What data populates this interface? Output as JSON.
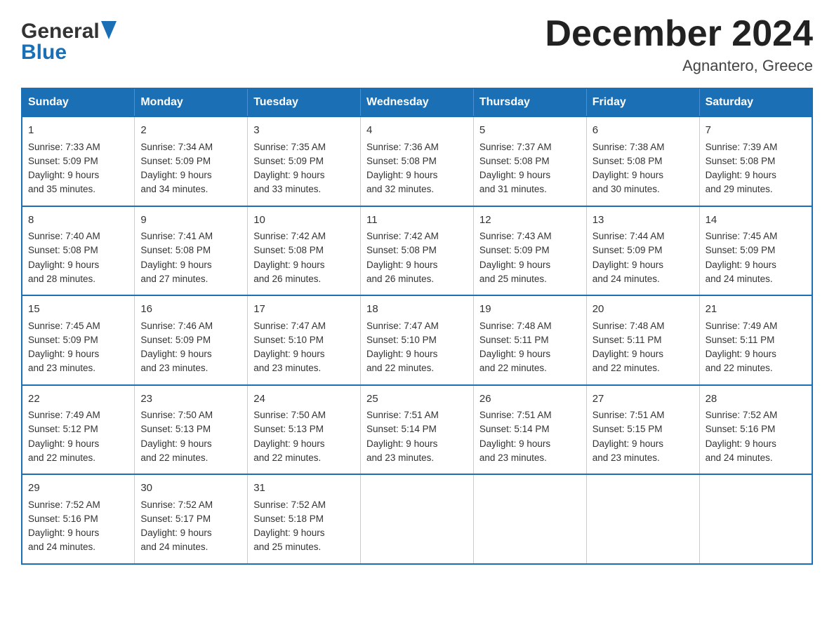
{
  "header": {
    "title": "December 2024",
    "location": "Agnantero, Greece",
    "logo_general": "General",
    "logo_blue": "Blue"
  },
  "columns": [
    "Sunday",
    "Monday",
    "Tuesday",
    "Wednesday",
    "Thursday",
    "Friday",
    "Saturday"
  ],
  "weeks": [
    [
      {
        "day": "1",
        "sunrise": "7:33 AM",
        "sunset": "5:09 PM",
        "daylight": "9 hours and 35 minutes."
      },
      {
        "day": "2",
        "sunrise": "7:34 AM",
        "sunset": "5:09 PM",
        "daylight": "9 hours and 34 minutes."
      },
      {
        "day": "3",
        "sunrise": "7:35 AM",
        "sunset": "5:09 PM",
        "daylight": "9 hours and 33 minutes."
      },
      {
        "day": "4",
        "sunrise": "7:36 AM",
        "sunset": "5:08 PM",
        "daylight": "9 hours and 32 minutes."
      },
      {
        "day": "5",
        "sunrise": "7:37 AM",
        "sunset": "5:08 PM",
        "daylight": "9 hours and 31 minutes."
      },
      {
        "day": "6",
        "sunrise": "7:38 AM",
        "sunset": "5:08 PM",
        "daylight": "9 hours and 30 minutes."
      },
      {
        "day": "7",
        "sunrise": "7:39 AM",
        "sunset": "5:08 PM",
        "daylight": "9 hours and 29 minutes."
      }
    ],
    [
      {
        "day": "8",
        "sunrise": "7:40 AM",
        "sunset": "5:08 PM",
        "daylight": "9 hours and 28 minutes."
      },
      {
        "day": "9",
        "sunrise": "7:41 AM",
        "sunset": "5:08 PM",
        "daylight": "9 hours and 27 minutes."
      },
      {
        "day": "10",
        "sunrise": "7:42 AM",
        "sunset": "5:08 PM",
        "daylight": "9 hours and 26 minutes."
      },
      {
        "day": "11",
        "sunrise": "7:42 AM",
        "sunset": "5:08 PM",
        "daylight": "9 hours and 26 minutes."
      },
      {
        "day": "12",
        "sunrise": "7:43 AM",
        "sunset": "5:09 PM",
        "daylight": "9 hours and 25 minutes."
      },
      {
        "day": "13",
        "sunrise": "7:44 AM",
        "sunset": "5:09 PM",
        "daylight": "9 hours and 24 minutes."
      },
      {
        "day": "14",
        "sunrise": "7:45 AM",
        "sunset": "5:09 PM",
        "daylight": "9 hours and 24 minutes."
      }
    ],
    [
      {
        "day": "15",
        "sunrise": "7:45 AM",
        "sunset": "5:09 PM",
        "daylight": "9 hours and 23 minutes."
      },
      {
        "day": "16",
        "sunrise": "7:46 AM",
        "sunset": "5:09 PM",
        "daylight": "9 hours and 23 minutes."
      },
      {
        "day": "17",
        "sunrise": "7:47 AM",
        "sunset": "5:10 PM",
        "daylight": "9 hours and 23 minutes."
      },
      {
        "day": "18",
        "sunrise": "7:47 AM",
        "sunset": "5:10 PM",
        "daylight": "9 hours and 22 minutes."
      },
      {
        "day": "19",
        "sunrise": "7:48 AM",
        "sunset": "5:11 PM",
        "daylight": "9 hours and 22 minutes."
      },
      {
        "day": "20",
        "sunrise": "7:48 AM",
        "sunset": "5:11 PM",
        "daylight": "9 hours and 22 minutes."
      },
      {
        "day": "21",
        "sunrise": "7:49 AM",
        "sunset": "5:11 PM",
        "daylight": "9 hours and 22 minutes."
      }
    ],
    [
      {
        "day": "22",
        "sunrise": "7:49 AM",
        "sunset": "5:12 PM",
        "daylight": "9 hours and 22 minutes."
      },
      {
        "day": "23",
        "sunrise": "7:50 AM",
        "sunset": "5:13 PM",
        "daylight": "9 hours and 22 minutes."
      },
      {
        "day": "24",
        "sunrise": "7:50 AM",
        "sunset": "5:13 PM",
        "daylight": "9 hours and 22 minutes."
      },
      {
        "day": "25",
        "sunrise": "7:51 AM",
        "sunset": "5:14 PM",
        "daylight": "9 hours and 23 minutes."
      },
      {
        "day": "26",
        "sunrise": "7:51 AM",
        "sunset": "5:14 PM",
        "daylight": "9 hours and 23 minutes."
      },
      {
        "day": "27",
        "sunrise": "7:51 AM",
        "sunset": "5:15 PM",
        "daylight": "9 hours and 23 minutes."
      },
      {
        "day": "28",
        "sunrise": "7:52 AM",
        "sunset": "5:16 PM",
        "daylight": "9 hours and 24 minutes."
      }
    ],
    [
      {
        "day": "29",
        "sunrise": "7:52 AM",
        "sunset": "5:16 PM",
        "daylight": "9 hours and 24 minutes."
      },
      {
        "day": "30",
        "sunrise": "7:52 AM",
        "sunset": "5:17 PM",
        "daylight": "9 hours and 24 minutes."
      },
      {
        "day": "31",
        "sunrise": "7:52 AM",
        "sunset": "5:18 PM",
        "daylight": "9 hours and 25 minutes."
      },
      null,
      null,
      null,
      null
    ]
  ]
}
